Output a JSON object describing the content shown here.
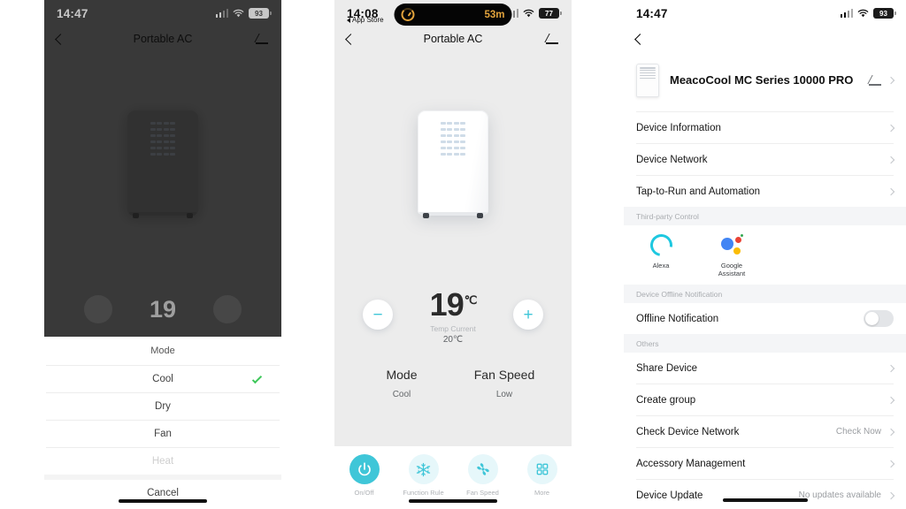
{
  "screen1": {
    "statusbar": {
      "time": "14:47",
      "battery": "93",
      "wifi_icon": "wifi-icon",
      "signal_icon": "cellular-signal-icon"
    },
    "nav": {
      "back_icon": "back-chevron-icon",
      "title": "Portable AC",
      "edit_icon": "pencil-edit-icon"
    },
    "device_icon": "portable-ac-device-image",
    "background_temp": "19",
    "sheet": {
      "header": "Mode",
      "options": [
        {
          "label": "Cool",
          "selected": true,
          "disabled": false
        },
        {
          "label": "Dry",
          "selected": false,
          "disabled": false
        },
        {
          "label": "Fan",
          "selected": false,
          "disabled": false
        },
        {
          "label": "Heat",
          "selected": false,
          "disabled": true
        }
      ],
      "cancel": "Cancel",
      "check_icon": "checkmark-icon"
    }
  },
  "screen2": {
    "statusbar": {
      "time": "14:08",
      "return_to": "App Store",
      "battery": "77",
      "wifi_icon": "wifi-icon",
      "signal_icon": "cellular-signal-icon"
    },
    "island": {
      "timer": "53m",
      "icon": "timer-ring-icon"
    },
    "nav": {
      "back_icon": "back-chevron-icon",
      "title": "Portable AC",
      "edit_icon": "pencil-edit-icon"
    },
    "device_icon": "portable-ac-device-image",
    "controls": {
      "minus_label": "−",
      "plus_label": "+",
      "target_temp": "19",
      "target_unit": "℃",
      "current_label": "Temp Current",
      "current_value": "20℃",
      "mode_title": "Mode",
      "mode_value": "Cool",
      "fan_title": "Fan Speed",
      "fan_value": "Low"
    },
    "tabs": [
      {
        "label": "On/Off",
        "icon": "power-icon",
        "active": true
      },
      {
        "label": "Function Rule",
        "icon": "snowflake-icon",
        "active": false
      },
      {
        "label": "Fan Speed",
        "icon": "fan-icon",
        "active": false
      },
      {
        "label": "More",
        "icon": "grid-more-icon",
        "active": false
      }
    ],
    "accent": "#3fc6d8"
  },
  "screen3": {
    "statusbar": {
      "time": "14:47",
      "battery": "93",
      "wifi_icon": "wifi-icon",
      "signal_icon": "cellular-signal-icon"
    },
    "nav": {
      "back_icon": "back-chevron-icon"
    },
    "device": {
      "name": "MeacoCool MC Series 10000 PRO",
      "thumb_icon": "portable-ac-thumbnail",
      "edit_icon": "pencil-edit-icon"
    },
    "items_top": [
      {
        "label": "Device Information",
        "value": ""
      },
      {
        "label": "Device Network",
        "value": ""
      },
      {
        "label": "Tap-to-Run and Automation",
        "value": ""
      }
    ],
    "section_thirdparty": "Third-party Control",
    "thirdparty": [
      {
        "label": "Alexa",
        "icon": "alexa-icon"
      },
      {
        "label": "Google Assistant",
        "icon": "google-assistant-icon"
      }
    ],
    "section_offline": "Device Offline Notification",
    "offline": {
      "label": "Offline Notification",
      "enabled": false
    },
    "section_others": "Others",
    "items_others": [
      {
        "label": "Share Device",
        "value": ""
      },
      {
        "label": "Create group",
        "value": ""
      },
      {
        "label": "Check Device Network",
        "value": "Check Now"
      },
      {
        "label": "Accessory Management",
        "value": ""
      },
      {
        "label": "Device Update",
        "value": "No updates available"
      }
    ]
  }
}
